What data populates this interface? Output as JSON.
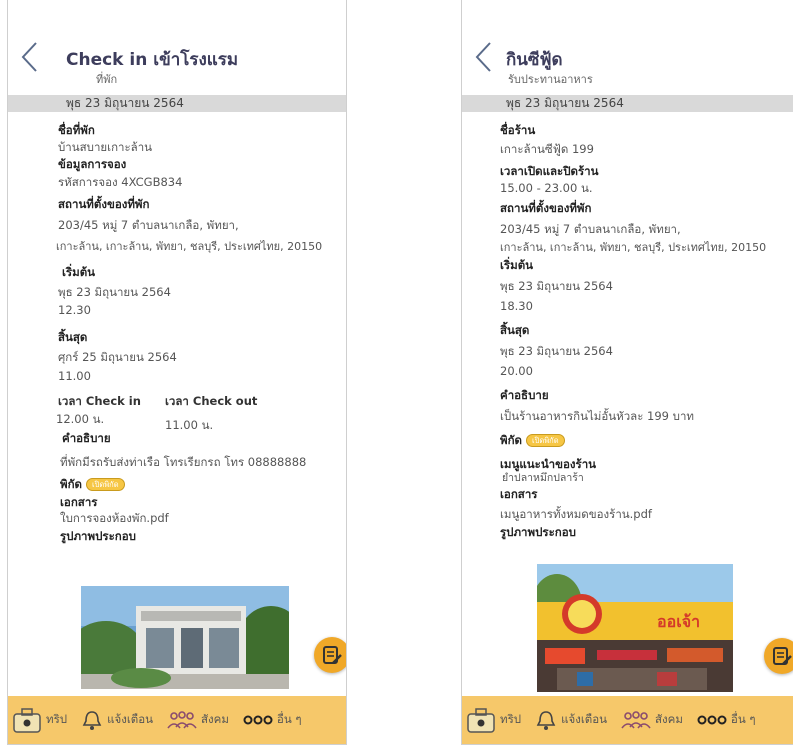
{
  "left": {
    "title": "Check in เข้าโรงแรม",
    "subtitle": "ที่พัก",
    "date": "พุธ 23 มิถุนายน 2564",
    "name_label": "ชื่อที่พัก",
    "name_value": "บ้านสบายเกาะล้าน",
    "booking_label": "ข้อมูลการจอง",
    "booking_value": "รหัสการจอง 4XCGB834",
    "address_label": "สถานที่ตั้งของที่พัก",
    "address_line1": "203/45 หมู่ 7 ตำบลนาเกลือ, พัทยา,",
    "address_line2": "เกาะล้าน, เกาะล้าน, พัทยา, ชลบุรี, ประเทศไทย, 20150",
    "start_label": "เริ่มต้น",
    "start_date": "พุธ 23 มิถุนายน 2564",
    "start_time": "12.30",
    "end_label": "สิ้นสุด",
    "end_date": "ศุกร์ 25 มิถุนายน 2564",
    "end_time": "11.00",
    "checkin_label": "เวลา Check in",
    "checkin_value": "12.00 น.",
    "checkout_label": "เวลา Check out",
    "checkout_value": "11.00 น.",
    "desc_label": "คำอธิบาย",
    "desc_value": "ที่พักมีรถรับส่งท่าเรือ โทรเรียกรถ โทร 08888888",
    "coord_label": "พิกัด",
    "coord_badge": "เปิดพิกัด",
    "doc_label": "เอกสาร",
    "doc_value": "ใบการจองห้องพัก.pdf",
    "photo_label": "รูปภาพประกอบ"
  },
  "right": {
    "title": "กินซีฟู้ด",
    "subtitle": "รับประทานอาหาร",
    "date": "พุธ 23 มิถุนายน 2564",
    "name_label": "ชื่อร้าน",
    "name_value": "เกาะล้านซีฟู้ด 199",
    "hours_label": "เวลาเปิดและปิดร้าน",
    "hours_value": "15.00 - 23.00 น.",
    "address_label": "สถานที่ตั้งของที่พัก",
    "address_line1": "203/45 หมู่ 7 ตำบลนาเกลือ, พัทยา,",
    "address_line2": "เกาะล้าน, เกาะล้าน, พัทยา, ชลบุรี, ประเทศไทย, 20150",
    "start_label": "เริ่มต้น",
    "start_date": "พุธ 23 มิถุนายน 2564",
    "start_time": "18.30",
    "end_label": "สิ้นสุด",
    "end_date": "พุธ 23 มิถุนายน 2564",
    "end_time": "20.00",
    "desc_label": "คำอธิบาย",
    "desc_value": "เป็นร้านอาหารกินไม่อั้นหัวละ 199 บาท",
    "coord_label": "พิกัด",
    "coord_badge": "เปิดพิกัด",
    "menu_label": "เมนูแนะนำของร้าน",
    "menu_value": "ยำปลาหมึกปลาร้า",
    "doc_label": "เอกสาร",
    "doc_value": "เมนูอาหารทั้งหมดของร้าน.pdf",
    "photo_label": "รูปภาพประกอบ",
    "shop_sign": "ออเจ้า"
  },
  "nav": {
    "trip": "ทริป",
    "notify": "แจ้งเตือน",
    "social": "สังคม",
    "more": "อื่น ๆ"
  },
  "colors": {
    "accent": "#f6c86a",
    "fab": "#f0a828",
    "title": "#3d3d5c"
  }
}
